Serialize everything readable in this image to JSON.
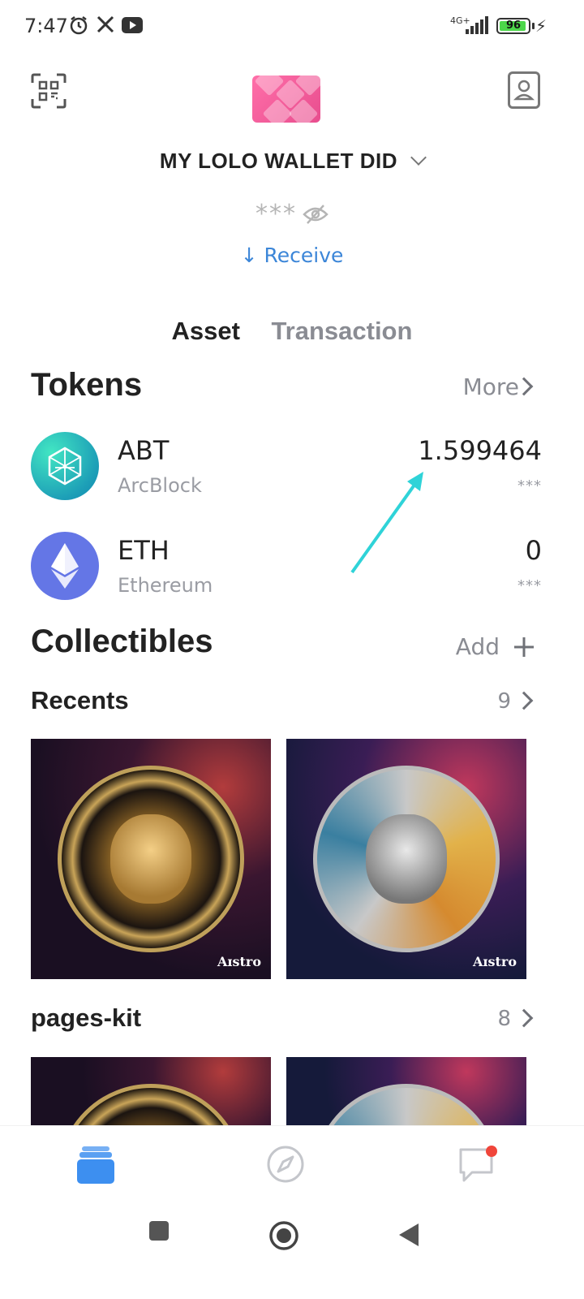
{
  "status_bar": {
    "time": "7:47",
    "network": "4G+",
    "battery": "96",
    "battery_level": 0.96
  },
  "header": {
    "wallet_name": "MY LOLO WALLET DID",
    "balance_masked": "***",
    "receive_label": "↓ Receive"
  },
  "tabs": [
    "Asset",
    "Transaction"
  ],
  "tokens_section": {
    "title": "Tokens",
    "more_label": "More",
    "items": [
      {
        "symbol": "ABT",
        "name": "ArcBlock",
        "amount": "1.599464",
        "fiat_masked": "***"
      },
      {
        "symbol": "ETH",
        "name": "Ethereum",
        "amount": "0",
        "fiat_masked": "***"
      }
    ]
  },
  "collectibles_section": {
    "title": "Collectibles",
    "add_label": "Add",
    "groups": [
      {
        "name": "Recents",
        "count": "9",
        "items": [
          {
            "label": "Aɪstro"
          },
          {
            "label": "Aɪstro"
          }
        ]
      },
      {
        "name": "pages-kit",
        "count": "8"
      }
    ]
  },
  "colors": {
    "accent": "#3c86d8",
    "annotation": "#2fd3d8",
    "nav_active": "#3d8ff0",
    "notification": "#f0453a"
  },
  "icons": {
    "status": [
      "alarm-icon",
      "x-logo-icon",
      "youtube-icon",
      "signal-icon",
      "battery-icon",
      "charging-icon"
    ],
    "header": [
      "qr-scan-icon",
      "profile-icon",
      "eye-off-icon"
    ],
    "bottom_nav": [
      "wallet-icon",
      "compass-icon",
      "chat-icon"
    ]
  }
}
